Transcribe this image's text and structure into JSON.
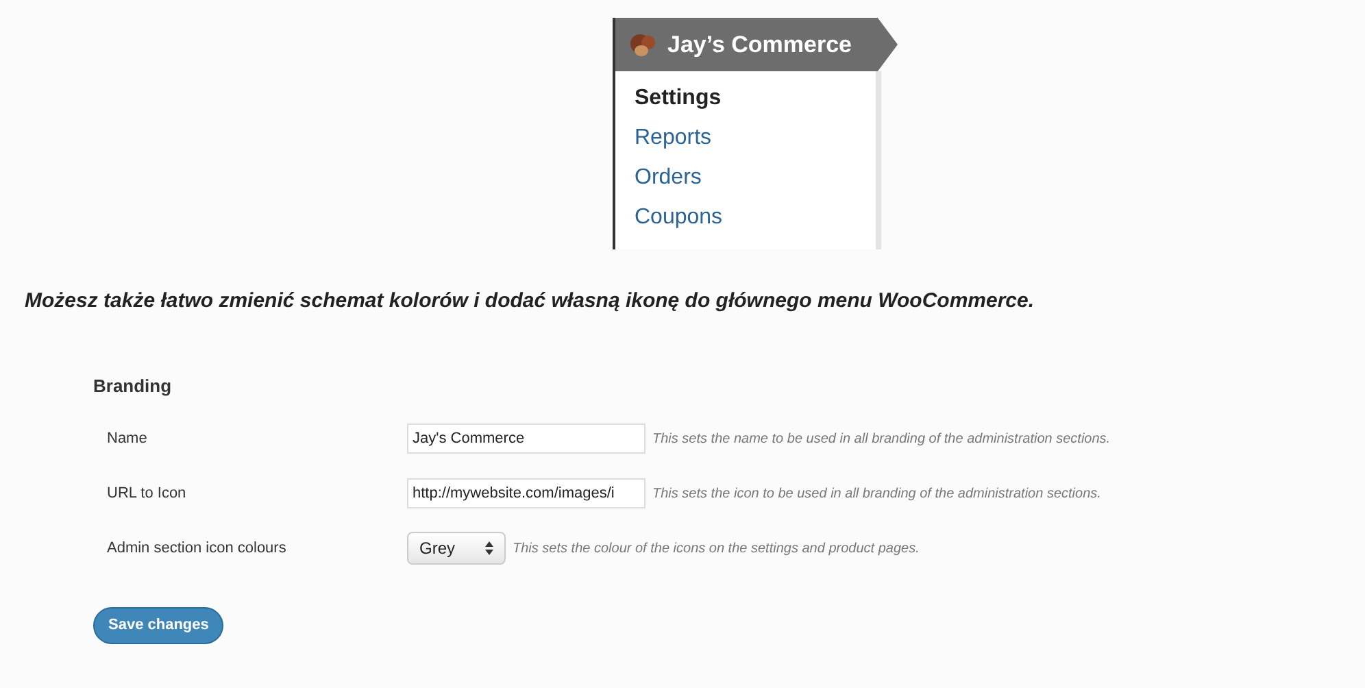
{
  "menu": {
    "title": "Jay’s Commerce",
    "items": [
      {
        "label": "Settings",
        "selected": true
      },
      {
        "label": "Reports",
        "selected": false
      },
      {
        "label": "Orders",
        "selected": false
      },
      {
        "label": "Coupons",
        "selected": false
      }
    ]
  },
  "caption": "Możesz także łatwo zmienić schemat kolorów i dodać własną ikonę do głównego menu WooCommerce.",
  "form": {
    "heading": "Branding",
    "rows": [
      {
        "kind": "text",
        "label": "Name",
        "value": "Jay's Commerce",
        "help": "This sets the name to be used in all branding of the administration sections."
      },
      {
        "kind": "text",
        "label": "URL to Icon",
        "value": "http://mywebsite.com/images/i",
        "help": "This sets the icon to be used in all branding of the administration sections."
      },
      {
        "kind": "select",
        "label": "Admin section icon colours",
        "value": "Grey",
        "help": "This sets the colour of the icons on the settings and product pages."
      }
    ],
    "button": "Save changes"
  }
}
